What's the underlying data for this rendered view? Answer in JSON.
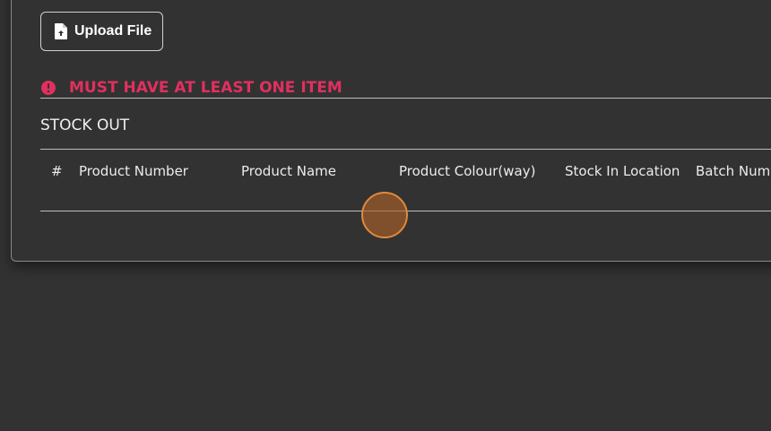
{
  "upload": {
    "label": "Upload File",
    "icon": "file-upload-icon"
  },
  "error": {
    "icon": "exclamation-circle-icon",
    "message": "MUST HAVE AT LEAST ONE ITEM",
    "color": "#e0305f"
  },
  "section": {
    "title": "STOCK OUT"
  },
  "table": {
    "columns": [
      "#",
      "Product Number",
      "Product Name",
      "Product Colour(way)",
      "Stock In Location",
      "Batch Num"
    ],
    "rows": []
  },
  "colors": {
    "background": "#323232",
    "accent_error": "#e0305f",
    "cursor": "#e08a3c"
  }
}
